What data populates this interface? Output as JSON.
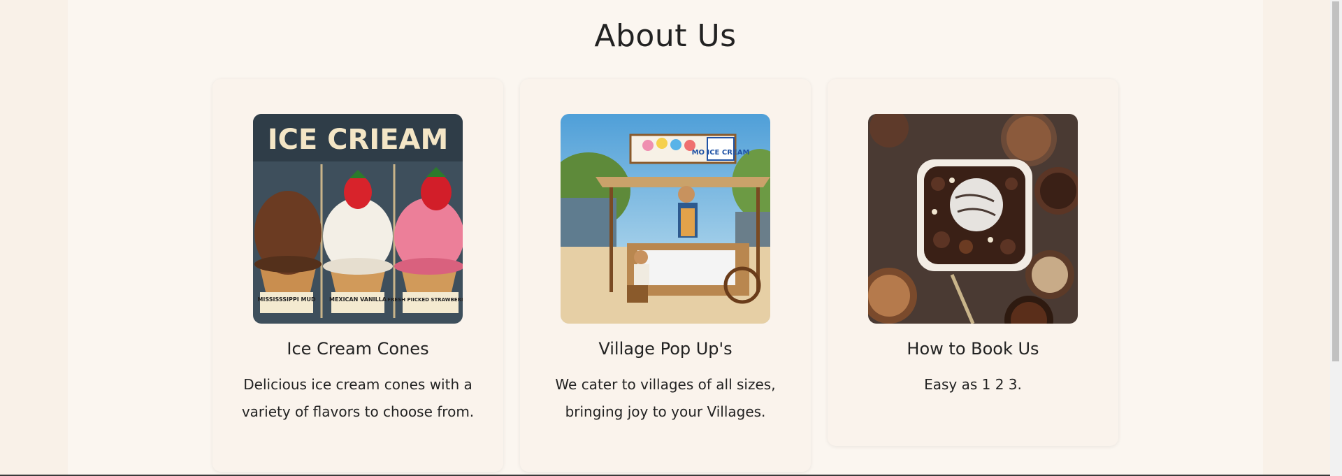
{
  "section": {
    "heading": "About Us"
  },
  "cards": [
    {
      "title": "Ice Cream Cones",
      "description": "Delicious ice cream cones with a variety of flavors to choose from.",
      "image_sign": "ICE CRIEAM",
      "image_labels": [
        "MISSISSSIPPI MUD",
        "MEXICAN VANILLA",
        "FRESH PIICKED STRAWBERRIES"
      ]
    },
    {
      "title": "Village Pop Up's",
      "description": "We cater to villages of all sizes, bringing joy to your Villages.",
      "image_sign": "MO ICE CREAM"
    },
    {
      "title": "How to Book Us",
      "description": "Easy as 1 2 3."
    }
  ]
}
